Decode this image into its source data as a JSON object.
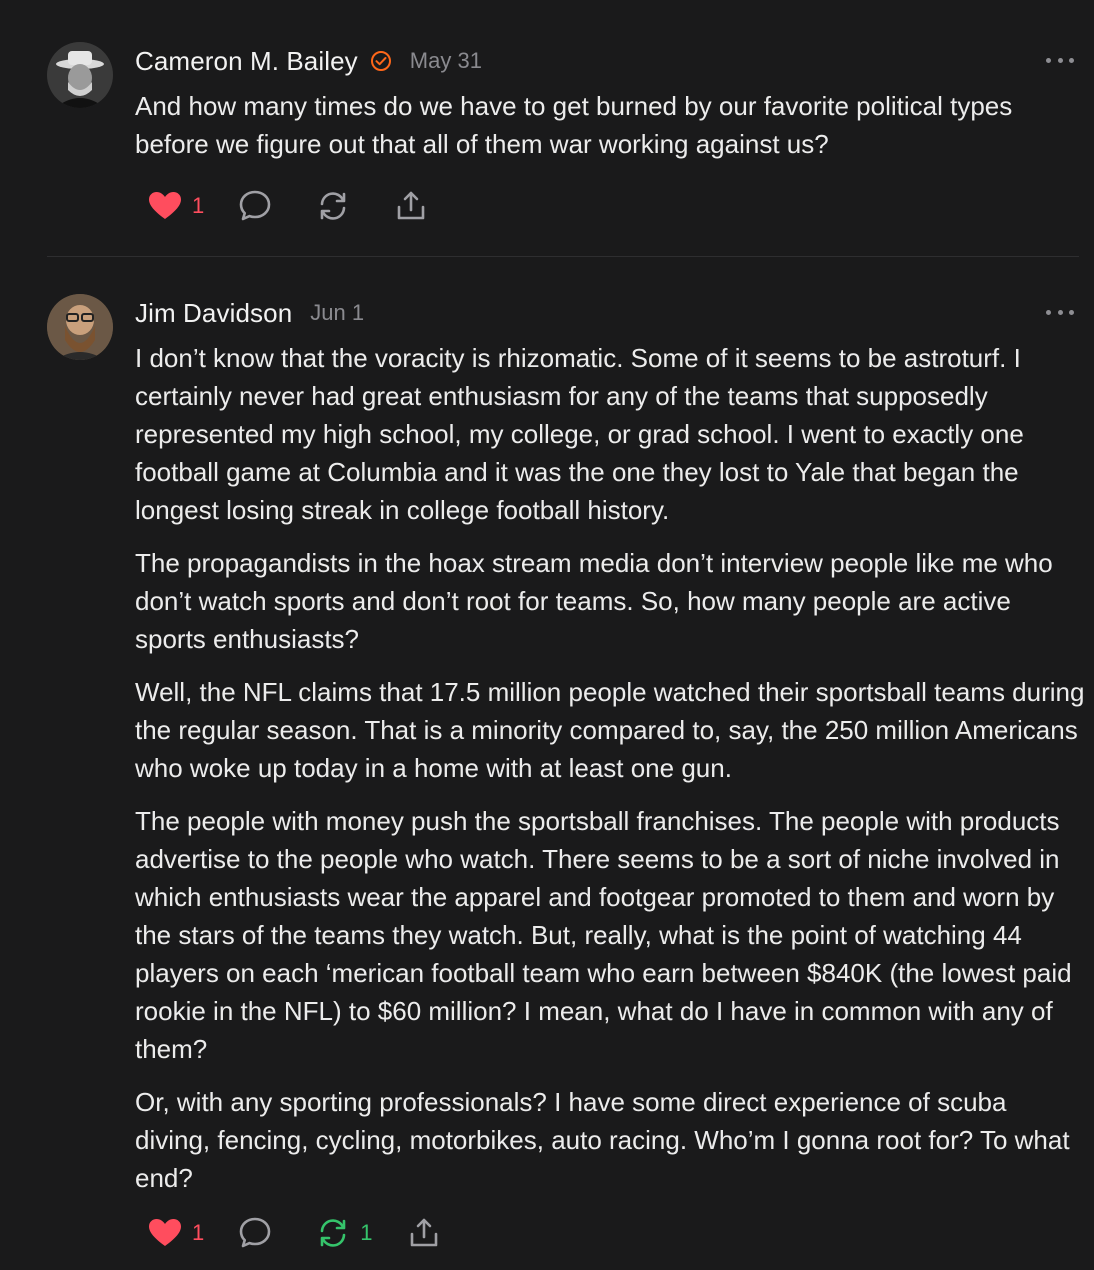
{
  "comments": [
    {
      "author": "Cameron M. Bailey",
      "verified": true,
      "date": "May 31",
      "paragraphs": [
        "And how many times do we have to get burned by our favorite political types before we figure out that all of them war working against us?"
      ],
      "likes": "1",
      "restacks": ""
    },
    {
      "author": "Jim Davidson",
      "verified": false,
      "date": "Jun 1",
      "paragraphs": [
        "I don’t know that the voracity is rhizomatic. Some of it seems to be astroturf. I certainly never had great enthusiasm for any of the teams that supposedly represented my high school, my college, or grad school. I went to exactly one football game at Columbia and it was the one they lost to Yale that began the longest losing streak in college football history.",
        "The propagandists in the hoax stream media don’t interview people like me who don’t watch sports and don’t root for teams. So, how many people are active sports enthusiasts?",
        "Well, the NFL claims that 17.5 million people watched their sportsball teams during the regular season. That is a minority compared to, say, the 250 million Americans who woke up today in a home with at least one gun.",
        "The people with money push the sportsball franchises. The people with products advertise to the people who watch. There seems to be a sort of niche involved in which enthusiasts wear the apparel and footgear promoted to them and worn by the stars of the teams they watch. But, really, what is the point of watching 44 players on each ‘merican football team who earn between $840K (the lowest paid rookie in the NFL) to $60 million? I mean, what do I have in common with any of them?",
        "Or, with any sporting professionals? I have some direct experience of scuba diving, fencing, cycling, motorbikes, auto racing. Who’m I gonna root for? To what end?"
      ],
      "likes": "1",
      "restacks": "1"
    }
  ],
  "icons": {
    "like": "heart-icon",
    "reply": "speech-bubble-icon",
    "restack": "refresh-arrows-icon",
    "share": "share-upload-icon",
    "more": "more-horizontal-icon",
    "verified": "verified-check-icon"
  },
  "colors": {
    "background": "#1a1a1b",
    "like_active": "#ff4d5e",
    "restack_active": "#35c46b",
    "verified": "#ff6719",
    "muted": "#8a8a8f"
  }
}
